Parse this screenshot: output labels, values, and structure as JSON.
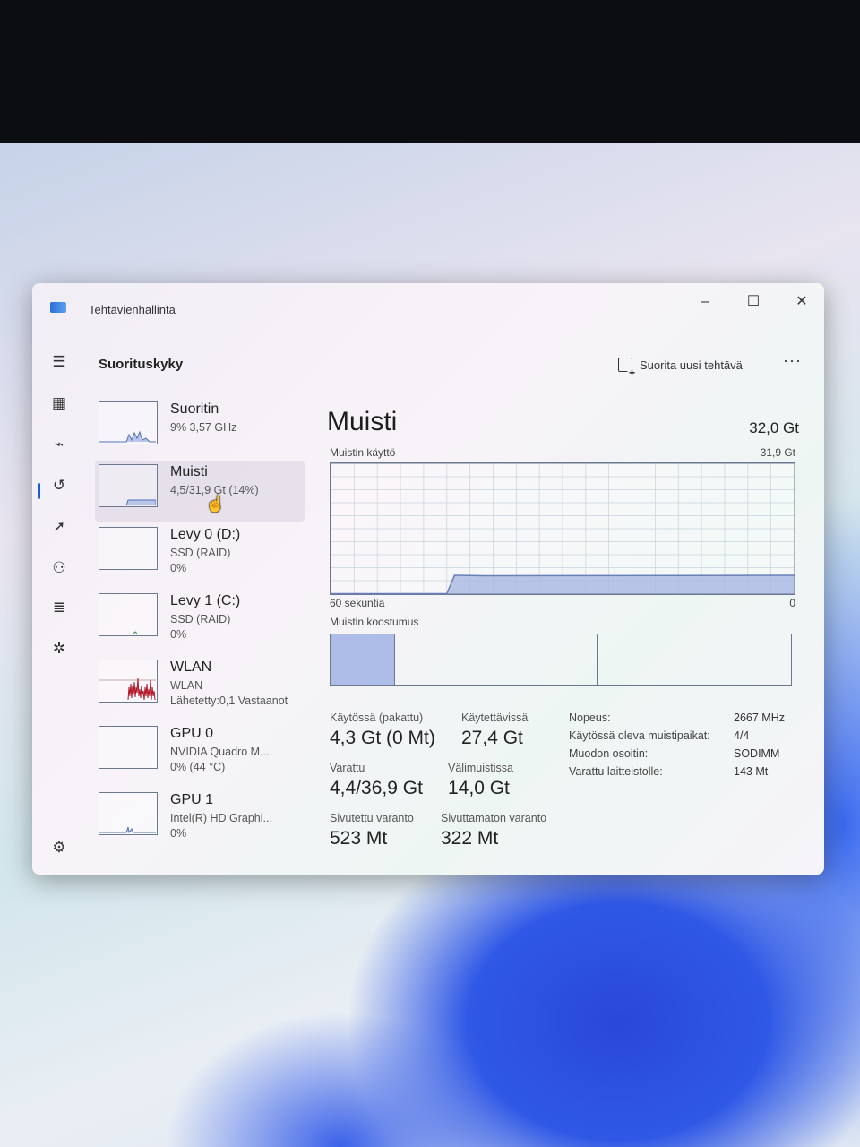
{
  "window": {
    "title": "Tehtävienhallinta",
    "controls": {
      "minimize": "–",
      "maximize": "☐",
      "close": "✕"
    }
  },
  "sidebar": {
    "items": [
      {
        "name": "hamburger-menu-icon",
        "glyph": "☰"
      },
      {
        "name": "processes-icon",
        "glyph": "▦"
      },
      {
        "name": "performance-icon",
        "glyph": "⌁",
        "active": true
      },
      {
        "name": "app-history-icon",
        "glyph": "↺"
      },
      {
        "name": "startup-apps-icon",
        "glyph": "➚"
      },
      {
        "name": "users-icon",
        "glyph": "⚇"
      },
      {
        "name": "details-icon",
        "glyph": "≣"
      },
      {
        "name": "services-icon",
        "glyph": "✲"
      }
    ],
    "settings_glyph": "⚙"
  },
  "header": {
    "page_title": "Suorituskyky",
    "run_task_label": "Suorita uusi tehtävä",
    "more_label": "···"
  },
  "devices": [
    {
      "name": "Suoritin",
      "line1": "9% 3,57 GHz",
      "line2": ""
    },
    {
      "name": "Muisti",
      "line1": "4,5/31,9 Gt (14%)",
      "line2": "",
      "selected": true
    },
    {
      "name": "Levy 0 (D:)",
      "line1": "SSD (RAID)",
      "line2": "0%"
    },
    {
      "name": "Levy 1 (C:)",
      "line1": "SSD (RAID)",
      "line2": "0%"
    },
    {
      "name": "WLAN",
      "line1": "WLAN",
      "line2": "Lähetetty:0,1 Vastaanot"
    },
    {
      "name": "GPU 0",
      "line1": "NVIDIA Quadro M...",
      "line2": "0% (44 °C)"
    },
    {
      "name": "GPU 1",
      "line1": "Intel(R) HD Graphi...",
      "line2": "0%"
    }
  ],
  "memory": {
    "title": "Muisti",
    "total": "32,0 Gt",
    "usage_label": "Muistin käyttö",
    "usage_max": "31,9 Gt",
    "axis_left": "60 sekuntia",
    "axis_right": "0",
    "composition_label": "Muistin koostumus",
    "stats": {
      "in_use_label": "Käytössä (pakattu)",
      "in_use_value": "4,3 Gt (0 Mt)",
      "available_label": "Käytettävissä",
      "available_value": "27,4 Gt",
      "committed_label": "Varattu",
      "committed_value": "4,4/36,9 Gt",
      "cached_label": "Välimuistissa",
      "cached_value": "14,0 Gt",
      "paged_label": "Sivutettu varanto",
      "paged_value": "523 Mt",
      "nonpaged_label": "Sivuttamaton varanto",
      "nonpaged_value": "322 Mt"
    },
    "specs": [
      {
        "label": "Nopeus:",
        "value": "2667 MHz"
      },
      {
        "label": "Käytössä oleva muistipaikat:",
        "value": "4/4"
      },
      {
        "label": "Muodon osoitin:",
        "value": "SODIMM"
      },
      {
        "label": "Varattu laitteistolle:",
        "value": "143 Mt"
      }
    ]
  },
  "chart_data": {
    "type": "area",
    "ylabel": "Muistin käyttö",
    "ylim": [
      0,
      31.9
    ],
    "xlim": [
      60,
      0
    ],
    "x": [
      60,
      54,
      50,
      45,
      44,
      40,
      0
    ],
    "values": [
      0,
      0,
      0,
      0,
      4.5,
      4.4,
      4.5
    ],
    "composition_fractions": [
      0.14,
      0.44,
      0.42
    ],
    "colors": {
      "line": "#6a7fb8",
      "fill": "#a9b7e2",
      "grid": "#c7d3dc"
    }
  }
}
